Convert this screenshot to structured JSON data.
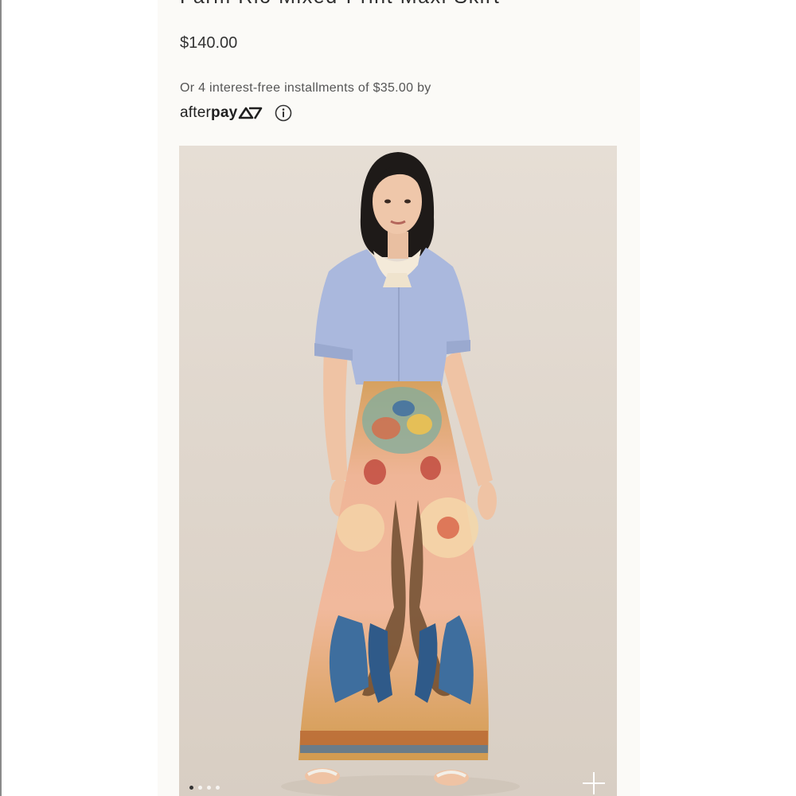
{
  "product": {
    "title": "Farm Rio Mixed-Print Maxi Skirt",
    "price": "$140.00"
  },
  "payment": {
    "installments_text": "Or 4 interest-free installments of $35.00 by",
    "provider_prefix": "after",
    "provider_suffix": "pay"
  },
  "gallery": {
    "image_subject": "model-wearing-peacock-print-maxi-skirt",
    "slide_count": 4,
    "active_slide": 1
  },
  "colors": {
    "background": "#fbfaf7",
    "text": "#333333",
    "image_backdrop": "#e3dbd2",
    "shirt": "#a9b7dc",
    "skirt_peach": "#f1b797",
    "skirt_blue": "#3e6e9e"
  }
}
